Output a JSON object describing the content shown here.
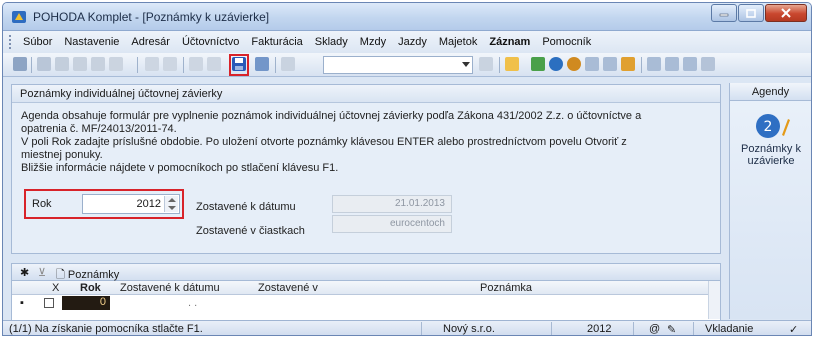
{
  "window": {
    "title": "POHODA Komplet - [Poznámky k uzávierke]"
  },
  "menu": [
    "Súbor",
    "Nastavenie",
    "Adresár",
    "Účtovníctvo",
    "Fakturácia",
    "Sklady",
    "Mzdy",
    "Jazdy",
    "Majetok",
    "Záznam",
    "Pomocník"
  ],
  "form": {
    "header": "Poznámky individuálnej účtovnej závierky",
    "description": [
      "Agenda obsahuje formulár pre vyplnenie poznámok individuálnej účtovnej závierky podľa Zákona 431/2002 Z.z. o účtovníctve a",
      "opatrenia č. MF/24013/2011-74.",
      "V poli Rok zadajte príslušné obdobie.  Po uložení otvorte  poznámky klávesou ENTER alebo prostredníctvom povelu Otvoriť z",
      "miestnej ponuky.",
      "Bližšie informácie nájdete v pomocníkoch po stlačení klávesu F1."
    ],
    "rok_label": "Rok",
    "rok_value": "2012",
    "zostavene_datum_label": "Zostavené k dátumu",
    "zostavene_datum_value": "21.01.2013",
    "zostavene_ciastky_label": "Zostavené v čiastkach",
    "zostavene_ciastky_value": "eurocentoch"
  },
  "grid": {
    "tab_label": "Poznámky",
    "columns": [
      "X",
      "Rok",
      "Zostavené k dátumu",
      "Zostavené v",
      "Poznámka"
    ],
    "row": {
      "rok": "0",
      "datum": ". ."
    }
  },
  "status": {
    "hint": "(1/1) Na získanie pomocníka stlačte F1.",
    "company": "Nový s.r.o.",
    "year": "2012",
    "mode": "Vkladanie"
  },
  "agenda": {
    "header": "Agendy",
    "item_label": "Poznámky k uzávierke"
  },
  "colors": {
    "highlight": "#d8232a",
    "accent": "#1f5fbf"
  }
}
